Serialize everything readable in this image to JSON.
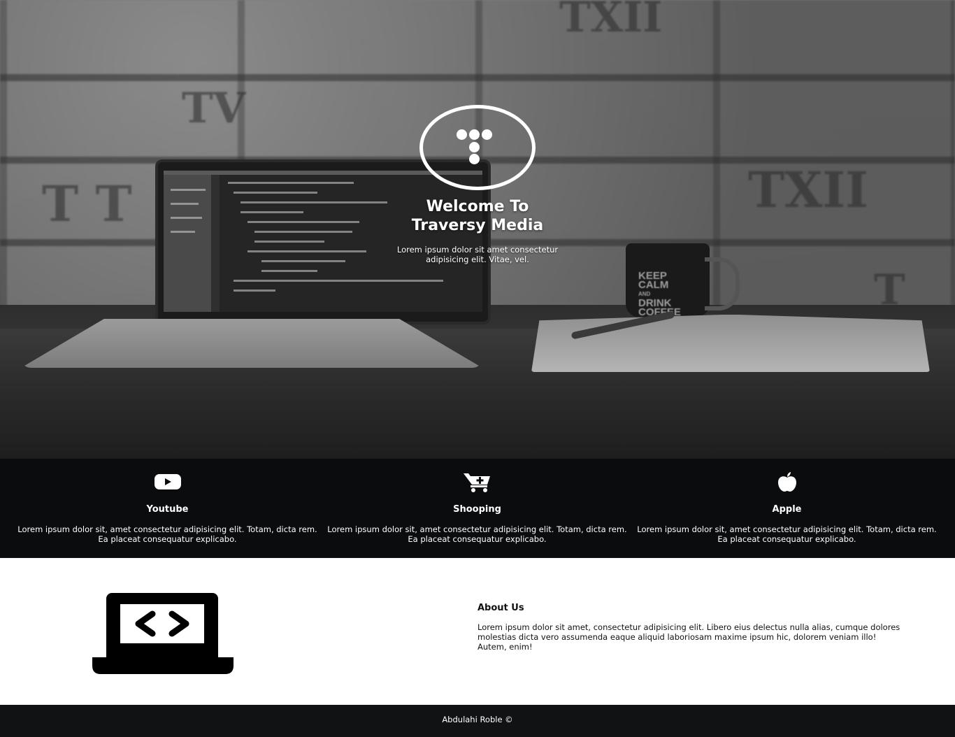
{
  "hero": {
    "title": "Welcome To Traversy Media",
    "subtitle": "Lorem ipsum dolor sit amet consectetur adipisicing elit. Vitae, vel.",
    "logo_icon": "traversy-logo-icon",
    "background": "workspace-photo",
    "mug_text": [
      "KEEP",
      "CALM",
      "AND",
      "DRINK",
      "COFFEE"
    ]
  },
  "features": [
    {
      "icon": "youtube-icon",
      "title": "Youtube",
      "text": "Lorem ipsum dolor sit, amet consectetur adipisicing elit. Totam, dicta rem. Ea placeat consequatur explicabo."
    },
    {
      "icon": "cart-plus-icon",
      "title": "Shooping",
      "text": "Lorem ipsum dolor sit, amet consectetur adipisicing elit. Totam, dicta rem. Ea placeat consequatur explicabo."
    },
    {
      "icon": "apple-icon",
      "title": "Apple",
      "text": "Lorem ipsum dolor sit, amet consectetur adipisicing elit. Totam, dicta rem. Ea placeat consequatur explicabo."
    }
  ],
  "about": {
    "icon": "laptop-code-icon",
    "title": "About Us",
    "text": "Lorem ipsum dolor sit amet, consectetur adipisicing elit. Libero eius delectus nulla alias, cumque dolores molestias dicta vero assumenda eaque aliquid laboriosam maxime ipsum hic, dolorem veniam illo! Autem, enim!"
  },
  "footer": {
    "text": "Abdulahi Roble ©"
  },
  "colors": {
    "features_bg": "#0b0c0e",
    "footer_bg": "#111213",
    "text_light": "#ffffff",
    "text_dark": "#111111"
  }
}
